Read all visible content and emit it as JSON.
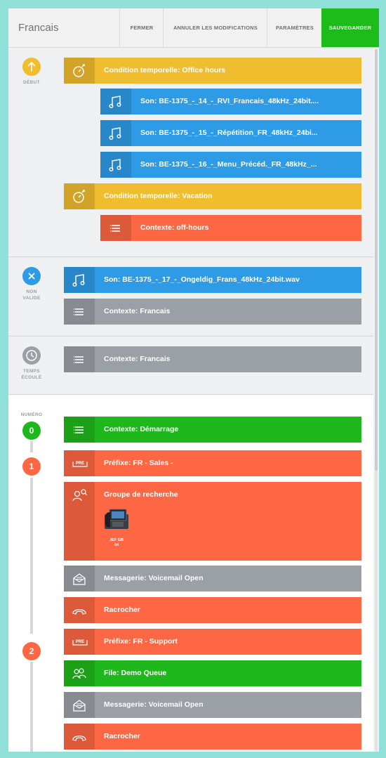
{
  "header": {
    "title": "Francais",
    "buttons": {
      "close": "FERMER",
      "cancel": "ANNULER LES MODIFICATIONS",
      "settings": "PARAMÈTRES",
      "save": "SAUVEGARDER"
    }
  },
  "sections": {
    "start": {
      "label": "DÉBUT",
      "rows": [
        {
          "text": "Condition temporelle: Office hours",
          "color": "yellow",
          "icon": "timer-icon"
        },
        {
          "text": "Son: BE-1375_-_14_-_RVI_Francais_48kHz_24bit....",
          "color": "blue",
          "icon": "music-note-icon"
        },
        {
          "text": "Son: BE-1375_-_15_-_Répétition_FR_48kHz_24bi...",
          "color": "blue",
          "icon": "music-note-icon"
        },
        {
          "text": "Son: BE-1375_-_16_-_Menu_Précéd._FR_48kHz_...",
          "color": "blue",
          "icon": "music-note-icon"
        },
        {
          "text": "Condition temporelle: Vacation",
          "color": "yellow",
          "icon": "timer-icon"
        },
        {
          "text": "Contexte: off-hours",
          "color": "orange",
          "icon": "list-icon"
        }
      ]
    },
    "invalid": {
      "label_line1": "NON",
      "label_line2": "VALIDE",
      "rows": [
        {
          "text": "Son: BE-1375_-_17_-_Ongeldig_Frans_48kHz_24bit.wav",
          "color": "blue",
          "icon": "music-note-icon"
        },
        {
          "text": "Contexte: Francais",
          "color": "gray",
          "icon": "list-icon"
        }
      ]
    },
    "timeout": {
      "label_line1": "TEMPS",
      "label_line2": "ÉCOULÉ",
      "rows": [
        {
          "text": "Contexte: Francais",
          "color": "gray",
          "icon": "list-icon"
        }
      ]
    },
    "number": {
      "label": "NUMÉRO",
      "digits": [
        "0",
        "1",
        "2"
      ],
      "rows": [
        {
          "text": "Contexte: Démarrage",
          "color": "green",
          "icon": "list-icon"
        },
        {
          "text": "Préfixe: FR - Sales -",
          "color": "orange",
          "icon": "prefix-icon",
          "badge": "PRE"
        },
        {
          "text": "Groupe de recherche",
          "color": "orange",
          "icon": "group-search-icon",
          "device_label_line1": "JEF GB",
          "device_label_line2": "64"
        },
        {
          "text": "Messagerie: Voicemail Open",
          "color": "gray",
          "icon": "voicemail-icon"
        },
        {
          "text": "Racrocher",
          "color": "orange",
          "icon": "hangup-icon"
        },
        {
          "text": "Préfixe: FR - Support",
          "color": "orange",
          "icon": "prefix-icon",
          "badge": "PRE"
        },
        {
          "text": "File: Demo Queue",
          "color": "green",
          "icon": "queue-icon"
        },
        {
          "text": "Messagerie: Voicemail Open",
          "color": "gray",
          "icon": "voicemail-icon"
        },
        {
          "text": "Racrocher",
          "color": "orange",
          "icon": "hangup-icon"
        }
      ]
    }
  },
  "colors": {
    "yellow": "#f0bd2f",
    "blue": "#2e9be7",
    "orange": "#fd6743",
    "gray": "#9b9fa6",
    "green": "#1fb81c",
    "save": "#1ebc1a",
    "frame_border": "#8fe0d9"
  }
}
